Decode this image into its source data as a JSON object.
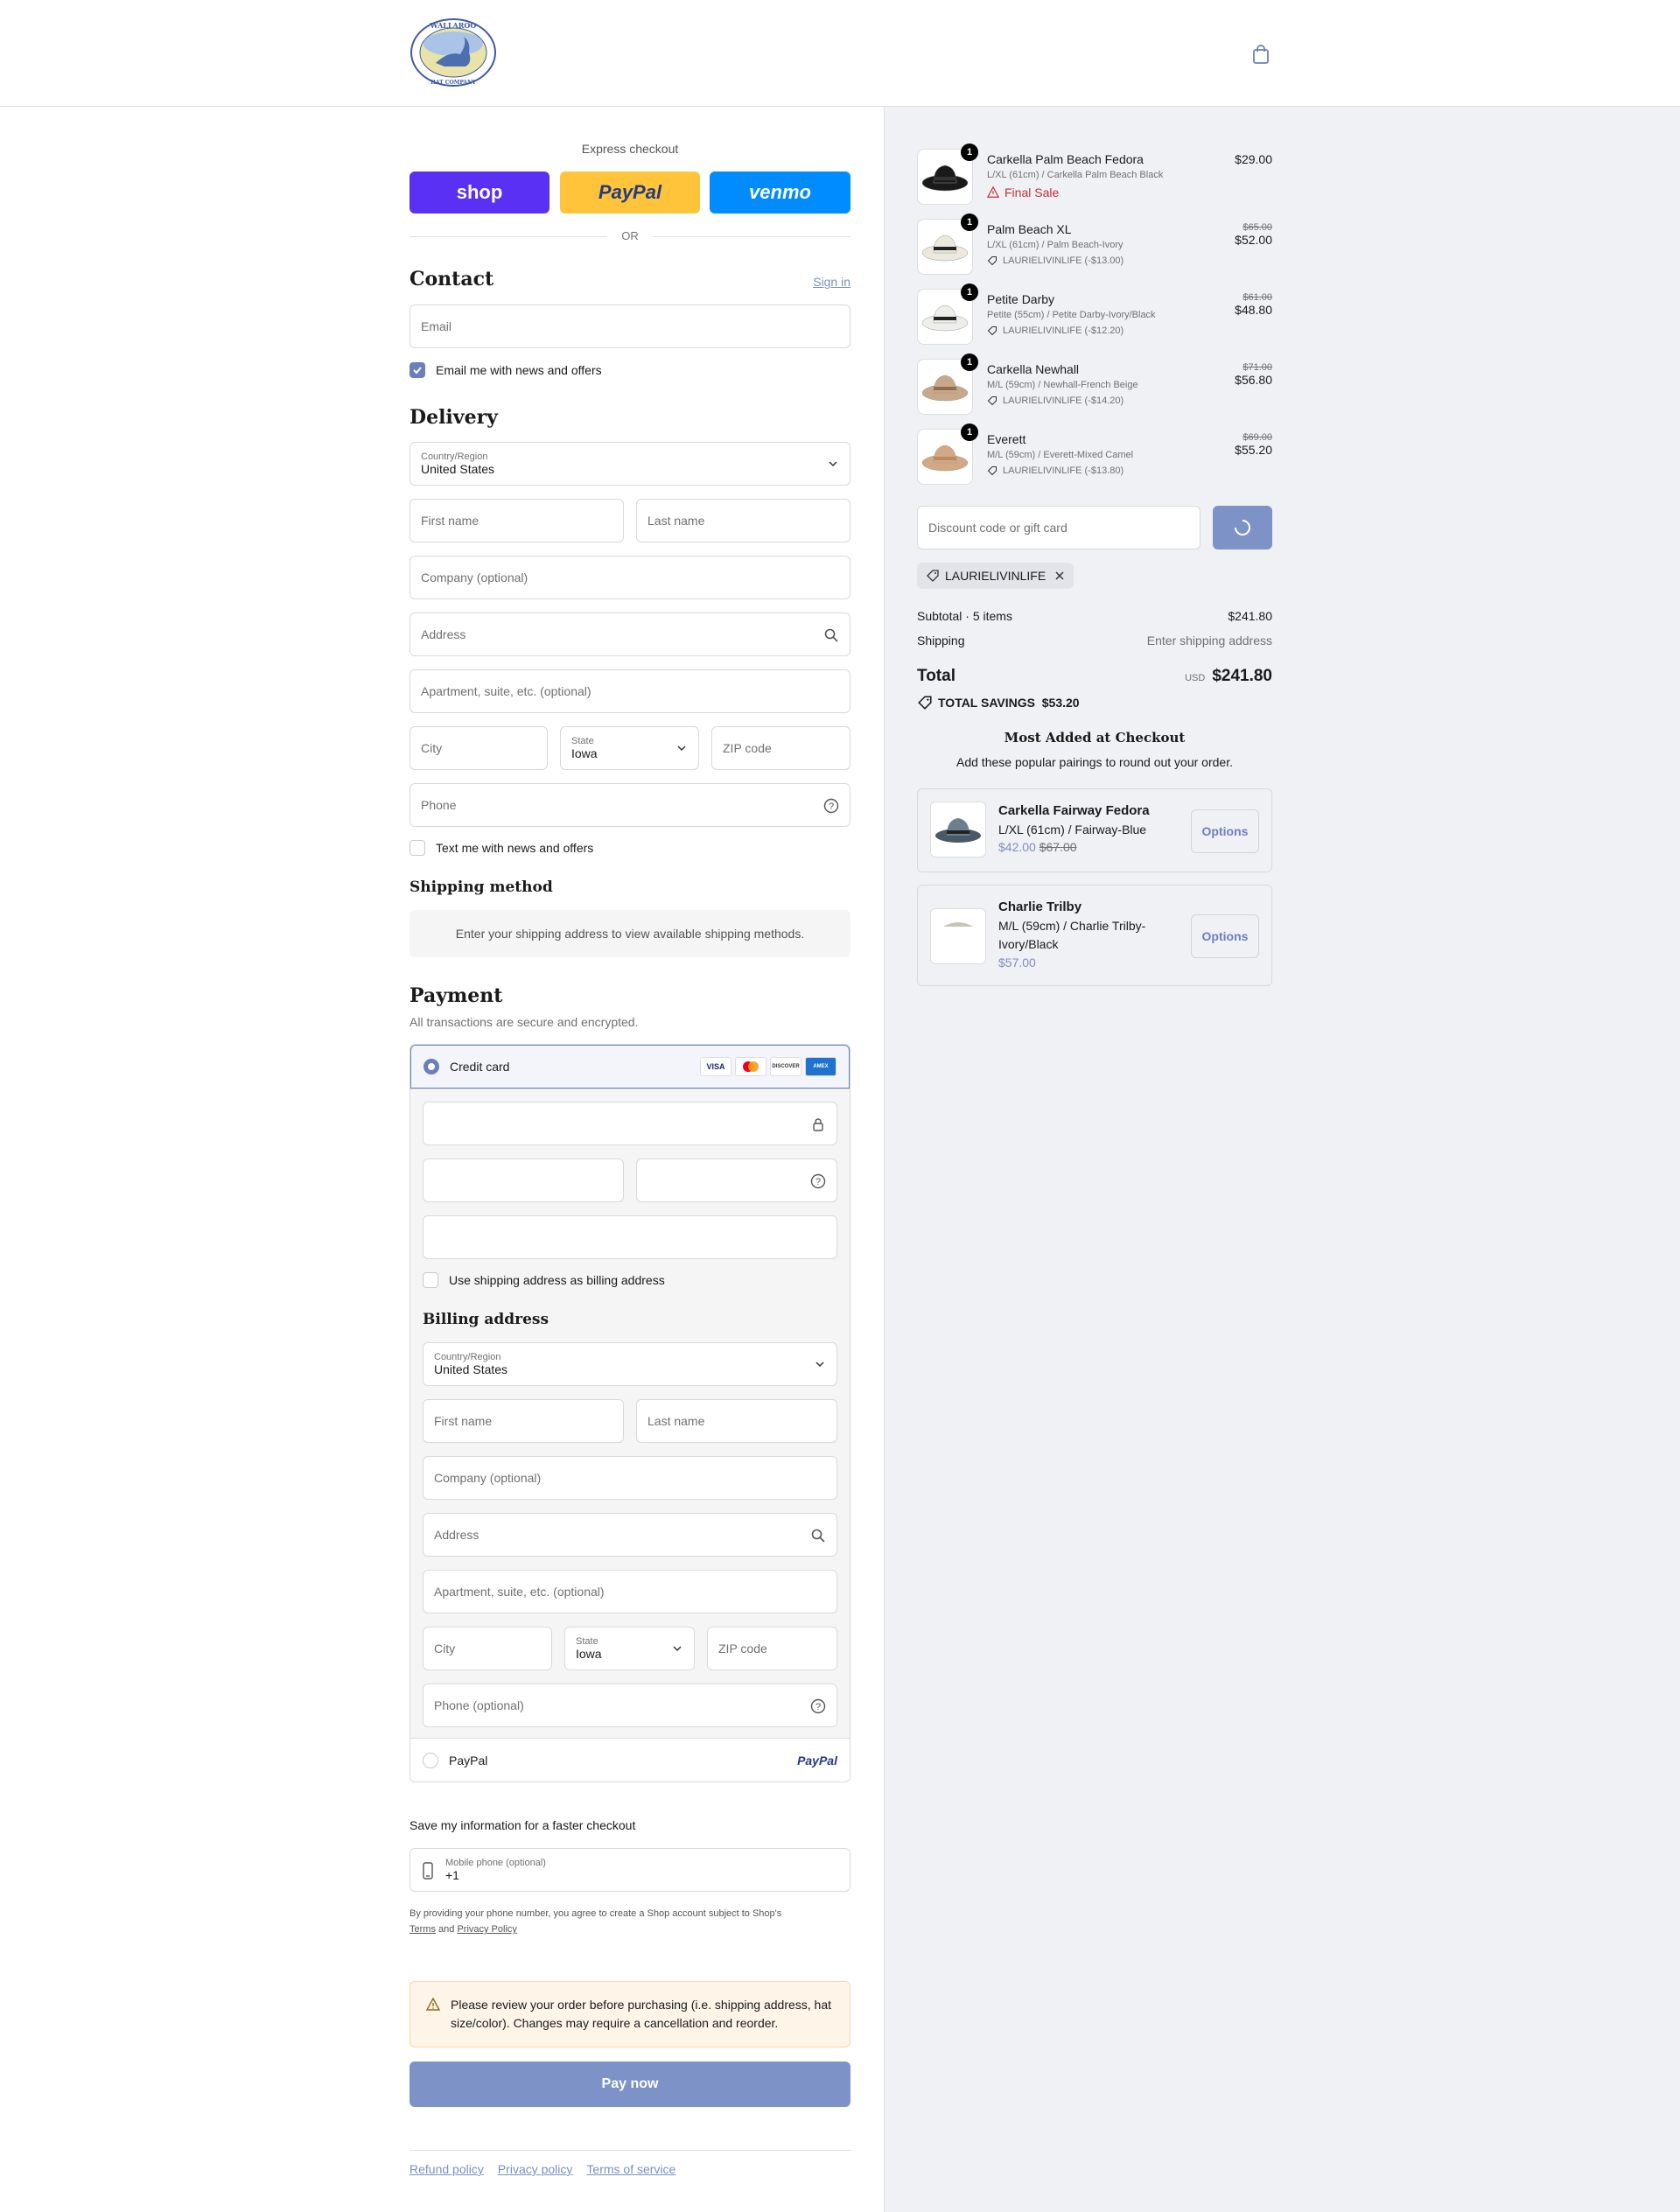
{
  "brand": {
    "name": "WALLAROO HAT COMPANY",
    "logo_top": "WALLAROO",
    "logo_bottom": "HAT COMPANY",
    "accent": "#6b7fbf"
  },
  "express": {
    "title": "Express checkout",
    "shop": "shop",
    "paypal": "PayPal",
    "venmo": "venmo",
    "or": "OR"
  },
  "contact": {
    "title": "Contact",
    "sign_in": "Sign in",
    "email_placeholder": "Email",
    "news_label": "Email me with news and offers",
    "news_checked": true
  },
  "delivery": {
    "title": "Delivery",
    "country_label": "Country/Region",
    "country_value": "United States",
    "first_name": "First name",
    "last_name": "Last name",
    "company": "Company (optional)",
    "address": "Address",
    "apartment": "Apartment, suite, etc. (optional)",
    "city": "City",
    "state_label": "State",
    "state_value": "Iowa",
    "zip": "ZIP code",
    "phone": "Phone",
    "text_label": "Text me with news and offers"
  },
  "shipping_method": {
    "title": "Shipping method",
    "note": "Enter your shipping address to view available shipping methods."
  },
  "payment": {
    "title": "Payment",
    "subtitle": "All transactions are secure and encrypted.",
    "credit_card": "Credit card",
    "cards": [
      "VISA",
      "MC",
      "DISCOVER",
      "AMEX"
    ],
    "use_shipping": "Use shipping address as billing address",
    "paypal": "PayPal",
    "paypal_logo": "PayPal"
  },
  "billing": {
    "title": "Billing address",
    "country_label": "Country/Region",
    "country_value": "United States",
    "first_name": "First name",
    "last_name": "Last name",
    "company": "Company (optional)",
    "address": "Address",
    "apartment": "Apartment, suite, etc. (optional)",
    "city": "City",
    "state_label": "State",
    "state_value": "Iowa",
    "zip": "ZIP code",
    "phone": "Phone (optional)"
  },
  "save_info": {
    "title": "Save my information for a faster checkout",
    "mobile_label": "Mobile phone (optional)",
    "mobile_value": "+1",
    "legal_prefix": "By providing your phone number, you agree to create a Shop account subject to Shop's",
    "terms": "Terms",
    "and": "and",
    "privacy": "Privacy Policy"
  },
  "warning": "Please review your order before purchasing (i.e. shipping address, hat size/color). Changes may require a cancellation and reorder.",
  "pay_now": "Pay now",
  "footer": {
    "refund": "Refund policy",
    "privacy": "Privacy policy",
    "terms": "Terms of service"
  },
  "cart": {
    "items": [
      {
        "qty": "1",
        "name": "Carkella Palm Beach Fedora",
        "variant": "L/XL (61cm) / Carkella Palm Beach Black",
        "final_sale": "Final Sale",
        "price": "$29.00",
        "hat_color": "#1a1a1a",
        "band": "#333333"
      },
      {
        "qty": "1",
        "name": "Palm Beach XL",
        "variant": "L/XL (61cm) / Palm Beach-Ivory",
        "discount": "LAURIELIVINLIFE (-$13.00)",
        "old_price": "$65.00",
        "price": "$52.00",
        "hat_color": "#ece8dc",
        "band": "#222222"
      },
      {
        "qty": "1",
        "name": "Petite Darby",
        "variant": "Petite (55cm) / Petite Darby-Ivory/Black",
        "discount": "LAURIELIVINLIFE (-$12.20)",
        "old_price": "$61.00",
        "price": "$48.80",
        "hat_color": "#eeeeea",
        "band": "#222222"
      },
      {
        "qty": "1",
        "name": "Carkella Newhall",
        "variant": "M/L (59cm) / Newhall-French Beige",
        "discount": "LAURIELIVINLIFE (-$14.20)",
        "old_price": "$71.00",
        "price": "$56.80",
        "hat_color": "#c9a88a",
        "band": "#8d6e55"
      },
      {
        "qty": "1",
        "name": "Everett",
        "variant": "M/L (59cm) / Everett-Mixed Camel",
        "discount": "LAURIELIVINLIFE (-$13.80)",
        "old_price": "$69.00",
        "price": "$55.20",
        "hat_color": "#d4a884",
        "band": "#b88a64"
      }
    ],
    "discount_placeholder": "Discount code or gift card",
    "applied_code": "LAURIELIVINLIFE",
    "subtotal_label": "Subtotal · 5 items",
    "subtotal": "$241.80",
    "shipping_label": "Shipping",
    "shipping_value": "Enter shipping address",
    "total_label": "Total",
    "currency": "USD",
    "total": "$241.80",
    "savings_label": "TOTAL SAVINGS",
    "savings": "$53.20"
  },
  "upsell": {
    "title": "Most Added at Checkout",
    "subtitle": "Add these popular pairings to round out your order.",
    "items": [
      {
        "name": "Carkella Fairway Fedora",
        "variant": "L/XL (61cm) / Fairway-Blue",
        "price": "$42.00",
        "old_price": "$67.00",
        "button": "Options"
      },
      {
        "name": "Charlie Trilby",
        "variant_line1": "M/L (59cm) / Charlie Trilby-",
        "variant_line2": "Ivory/Black",
        "price": "$57.00",
        "button": "Options"
      }
    ]
  }
}
